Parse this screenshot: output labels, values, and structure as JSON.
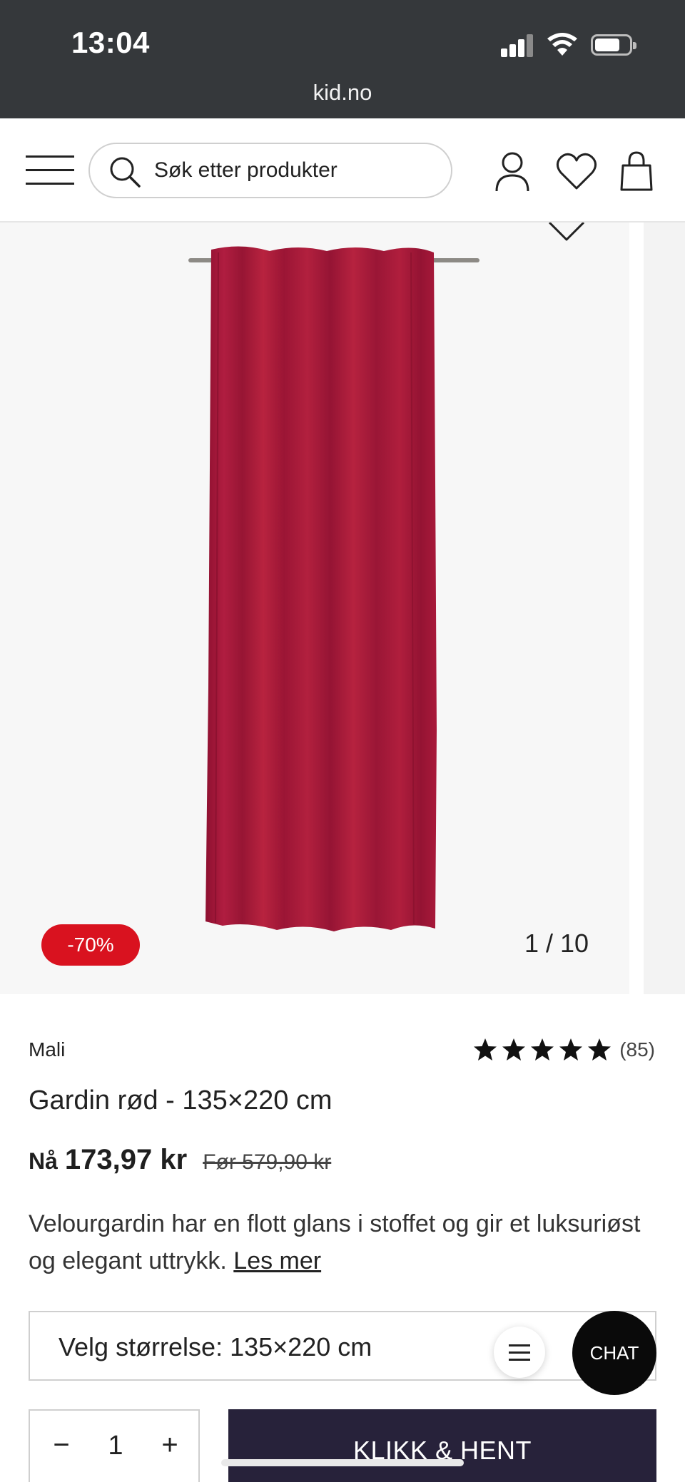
{
  "status_bar": {
    "time": "13:04"
  },
  "browser": {
    "url": "kid.no"
  },
  "header": {
    "search_placeholder": "Søk etter produkter"
  },
  "gallery": {
    "counter": "1 / 10",
    "discount_badge": "-70%"
  },
  "product": {
    "brand": "Mali",
    "rating_stars": 5,
    "rating_count": "(85)",
    "title": "Gardin rød - 135×220 cm",
    "price_now_label": "Nå",
    "price_now": "173,97 kr",
    "price_before": "Før 579,90 kr",
    "description": "Velourgardin har en flott glans i stoffet og gir et luksuriøst og elegant uttrykk.",
    "read_more": "Les mer",
    "size_select": "Velg størrelse: 135×220 cm",
    "quantity": "1",
    "quantity_minus": "−",
    "quantity_plus": "+",
    "cta_label": "KLIKK & HENT"
  },
  "widgets": {
    "chat_label": "CHAT"
  },
  "colors": {
    "discount": "#d9121f",
    "cta": "#27223a",
    "curtain": "#a8183a"
  }
}
